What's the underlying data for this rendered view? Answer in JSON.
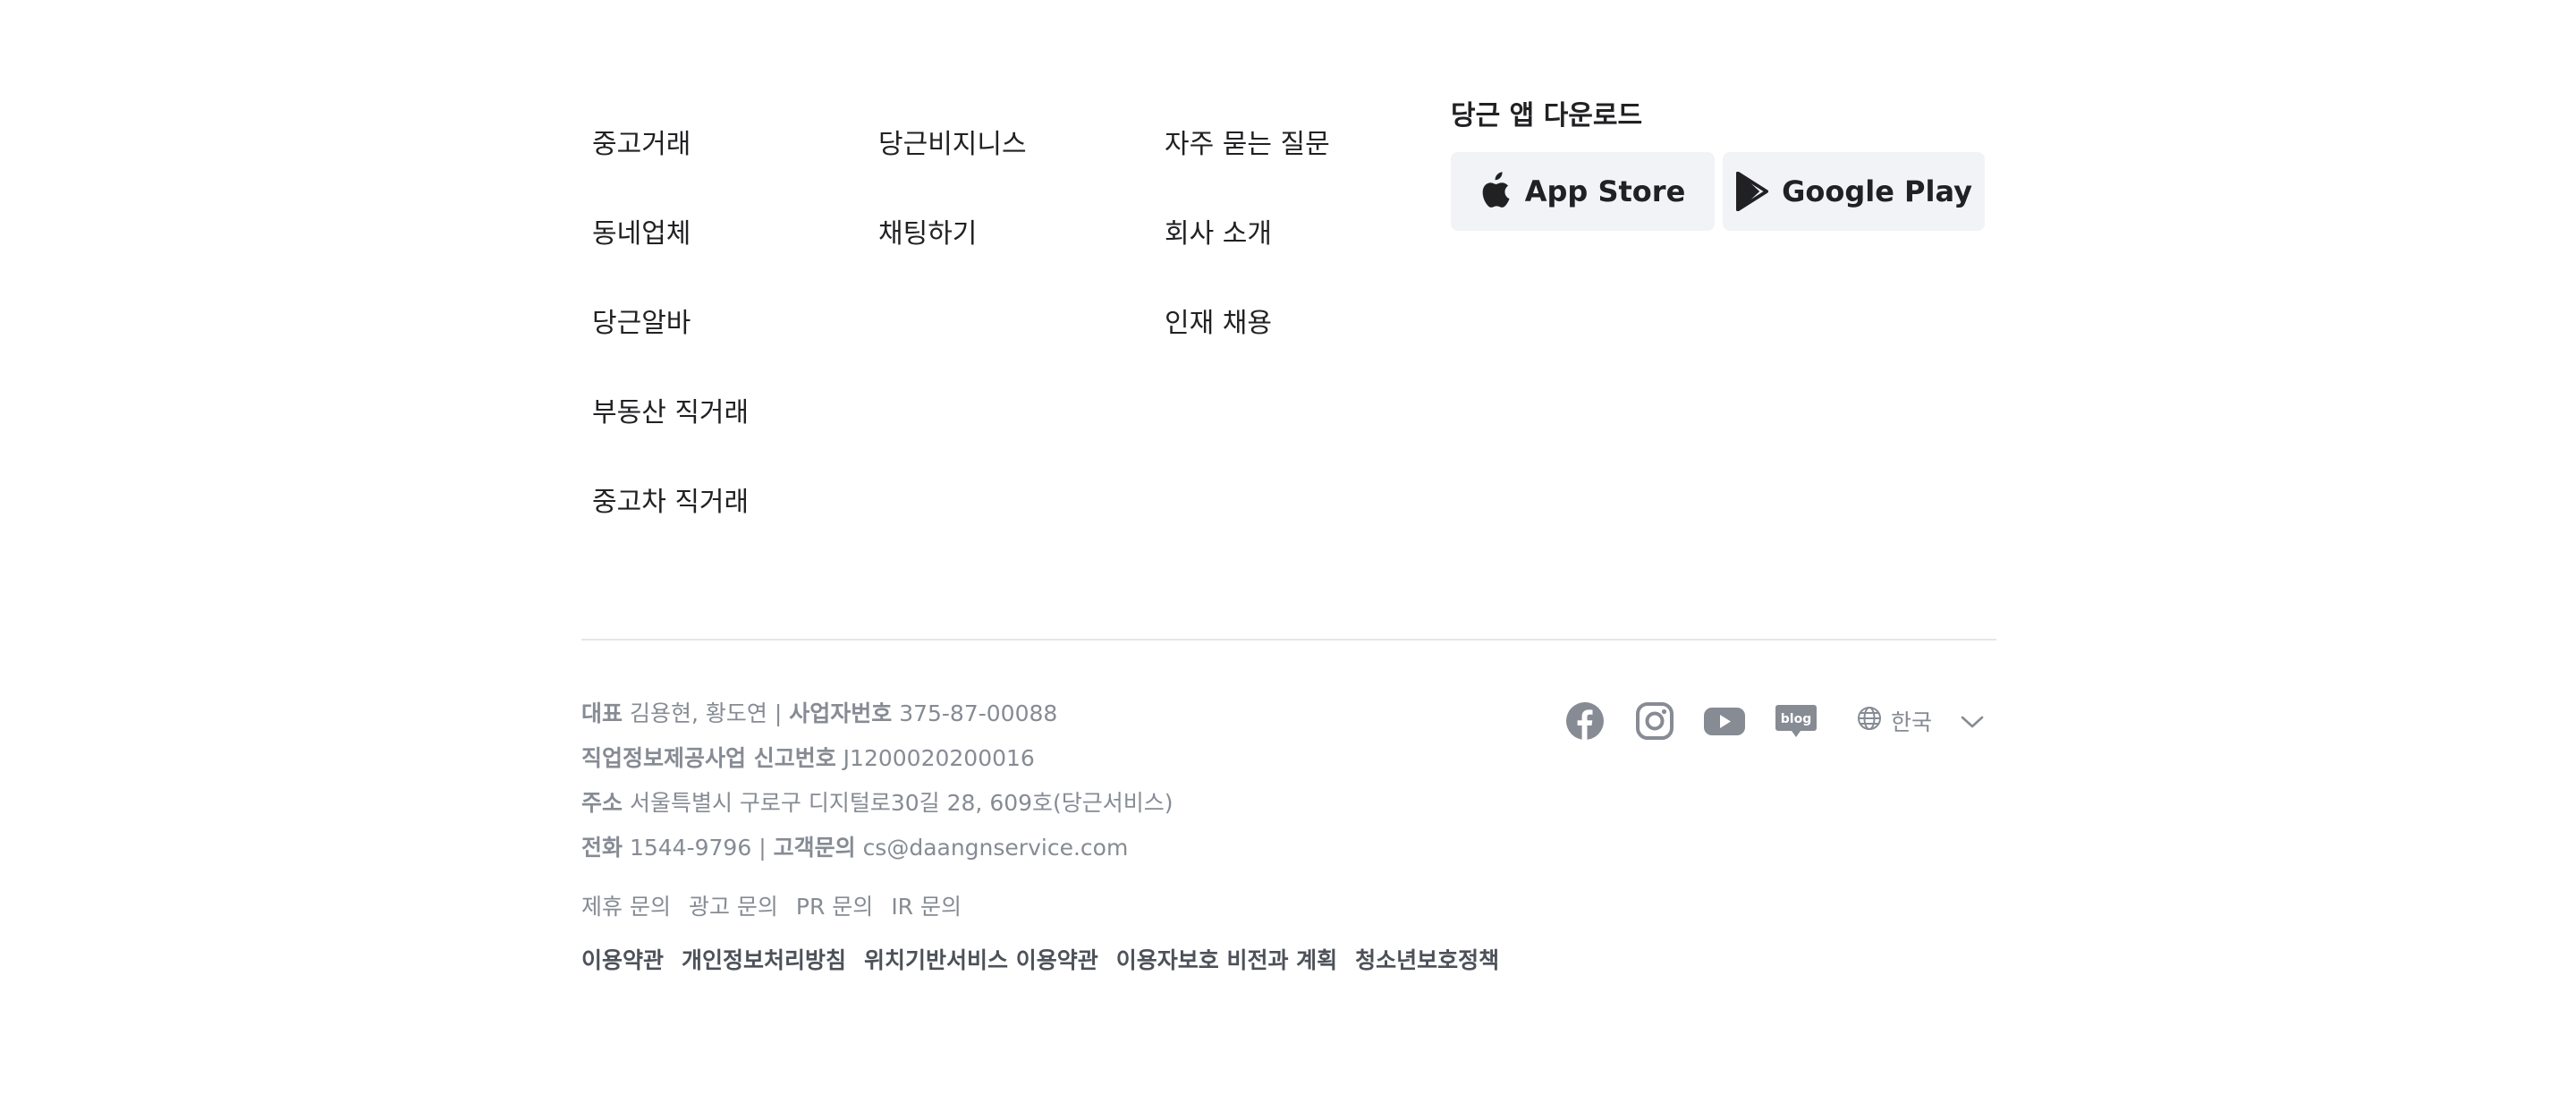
{
  "nav": {
    "col1": [
      "중고거래",
      "동네업체",
      "당근알바",
      "부동산 직거래",
      "중고차 직거래"
    ],
    "col2": [
      "당근비지니스",
      "채팅하기"
    ],
    "col3": [
      "자주 묻는 질문",
      "회사 소개",
      "인재 채용"
    ]
  },
  "download": {
    "title": "당근 앱 다운로드",
    "app_store": "App Store",
    "google_play": "Google Play"
  },
  "company": {
    "rep_label": "대표",
    "rep_value": "김용현, 황도연",
    "biz_label": "사업자번호",
    "biz_value": "375-87-00088",
    "job_label": "직업정보제공사업 신고번호",
    "job_value": "J1200020200016",
    "addr_label": "주소",
    "addr_value": "서울특별시 구로구 디지털로30길 28, 609호(당근서비스)",
    "phone_label": "전화",
    "phone_value": "1544-9796",
    "cs_label": "고객문의",
    "cs_value": "cs@daangnservice.com",
    "separator": "|"
  },
  "inquiries": [
    "제휴 문의",
    "광고 문의",
    "PR 문의",
    "IR 문의"
  ],
  "policies": [
    "이용약관",
    "개인정보처리방침",
    "위치기반서비스 이용약관",
    "이용자보호 비전과 계획",
    "청소년보호정책"
  ],
  "social": {
    "blog_text": "blog"
  },
  "language": {
    "selected": "한국"
  },
  "colors": {
    "text_primary": "#212124",
    "text_muted": "#868b94",
    "policy_text": "#4d5159",
    "button_bg": "#f2f3f6",
    "divider": "#e5e6e9"
  }
}
